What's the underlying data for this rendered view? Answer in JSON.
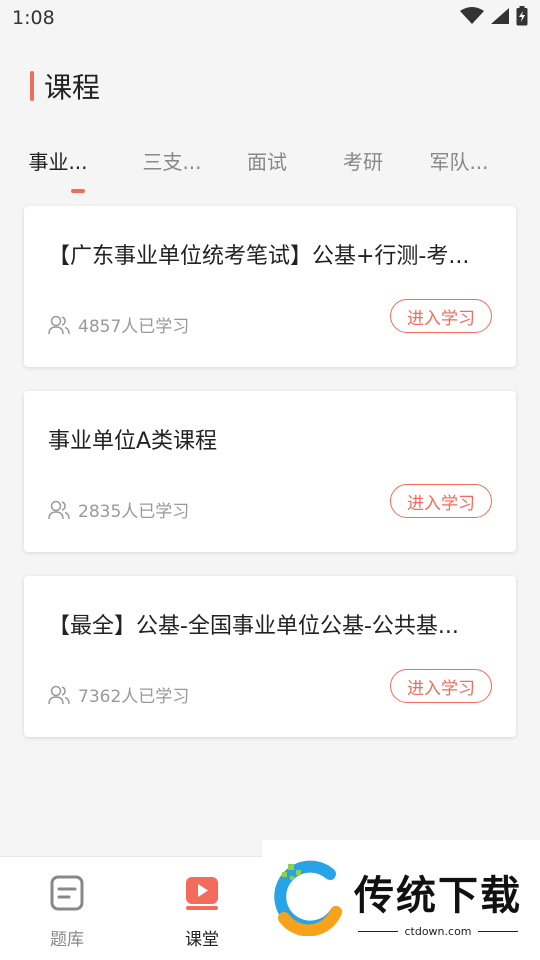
{
  "status_bar": {
    "time": "1:08"
  },
  "header": {
    "title": "课程"
  },
  "tabs": [
    {
      "label": "事业...",
      "active": true
    },
    {
      "label": "三支...",
      "active": false
    },
    {
      "label": "面试",
      "active": false
    },
    {
      "label": "考研",
      "active": false
    },
    {
      "label": "军队...",
      "active": false
    }
  ],
  "courses": [
    {
      "title": "【广东事业单位统考笔试】公基+行测-考...",
      "learners": "4857人已学习",
      "button": "进入学习"
    },
    {
      "title": "事业单位A类课程",
      "learners": "2835人已学习",
      "button": "进入学习"
    },
    {
      "title": "【最全】公基-全国事业单位公基-公共基...",
      "learners": "7362人已学习",
      "button": "进入学习"
    }
  ],
  "bottom_nav": [
    {
      "label": "题库",
      "icon": "question-bank-icon",
      "active": false
    },
    {
      "label": "课堂",
      "icon": "classroom-play-icon",
      "active": true
    }
  ],
  "watermark": {
    "title": "传统下载",
    "url": "ctdown.com"
  },
  "colors": {
    "accent": "#f26b5b",
    "background": "#f5f5f5"
  }
}
